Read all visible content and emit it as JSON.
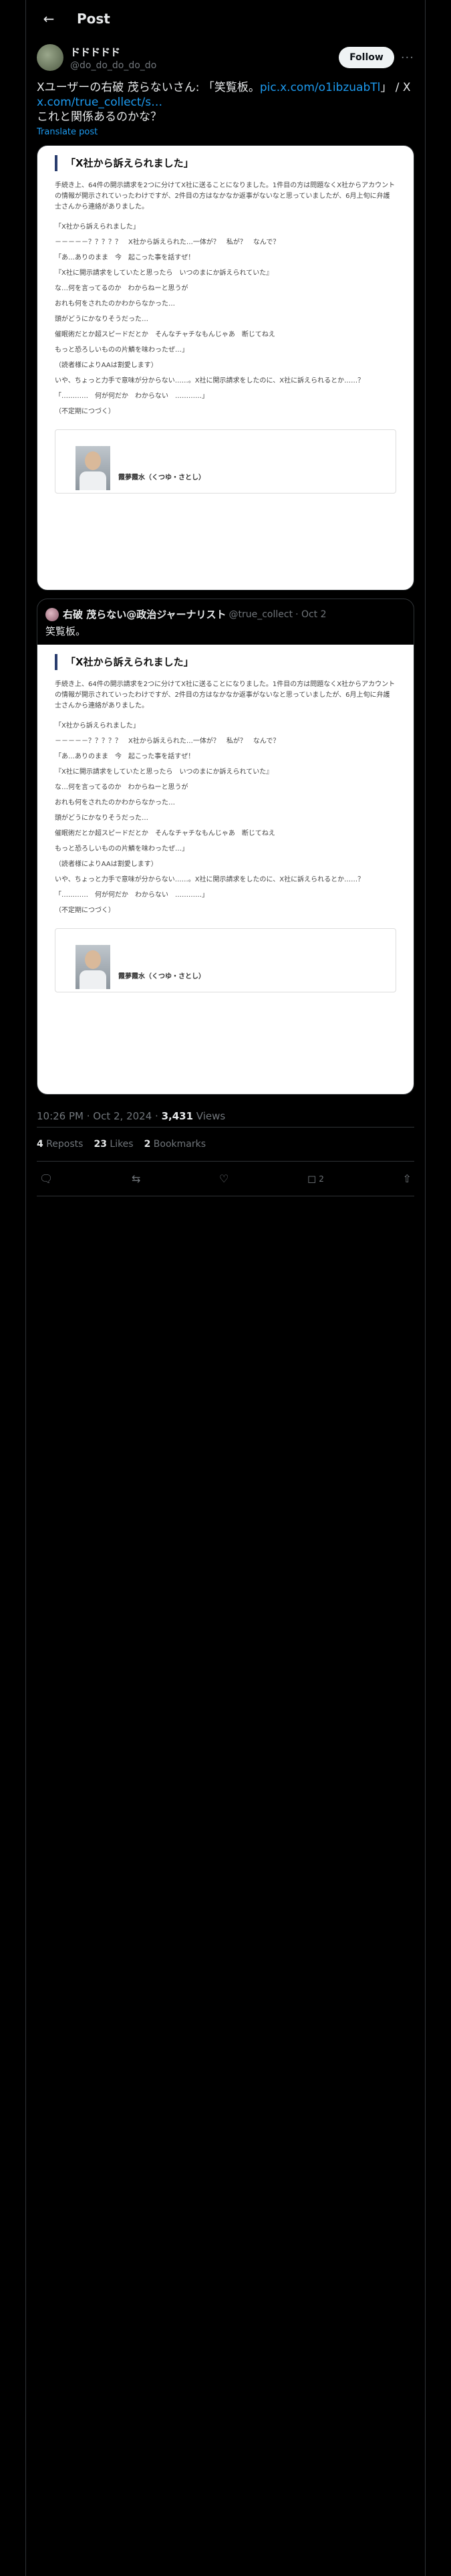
{
  "header": {
    "back_icon": "arrow-left-icon",
    "title": "Post"
  },
  "post": {
    "display_name": "ドドドドド",
    "handle": "@do_do_do_do_do",
    "follow_label": "Follow",
    "more_label": "···",
    "text_main": "Xユーザーの右破 茂らないさん: 「笑覧板。",
    "text_link1": "pic.x.com/o1ibzuabTl",
    "text_mid": "」 / X ",
    "text_link2": "x.com/true_collect/s…",
    "text_tail": "これと関係あるのかな？",
    "translate_label": "Translate post"
  },
  "article": {
    "title": "「X社から訴えられました」",
    "paragraphs": [
      "手続き上、64件の開示請求を2つに分けてX社に送ることになりました。1件目の方は問題なくX社からアカウントの情報が開示されていったわけですが、2件目の方はなかなか返事がないなと思っていましたが、6月上旬に弁護士さんから連絡がありました。",
      "「X社から訴えられました」",
      "－－－－－？？？？？　X社から訴えられた…一体が？　私が？　なんで？",
      "「あ…ありのまま　今　起こった事を話すぜ！",
      "『X社に開示請求をしていたと思ったら　いつのまにか訴えられていた』",
      "な…何を言ってるのか　わからねーと思うが",
      "おれも何をされたのかわからなかった…",
      "頭がどうにかなりそうだった…",
      "催眠術だとか超スピードだとか　そんなチャチなもんじゃあ　断じてねえ",
      "もっと恐ろしいものの片鱗を味わったぜ…」",
      "（読者様によりAAは割愛します）",
      "いや、ちょっと力手で意味が分からない……。X社に開示請求をしたのに、X社に訴えられるとか……？",
      "「…………　何が何だか　わからない　…………」",
      "（不定期につづく）"
    ],
    "author_caption": "霞夢霞水（くつゆ・さとし）"
  },
  "quote": {
    "display_name": "右破 茂らない@政治ジャーナリスト",
    "handle": "@true_collect",
    "date": "· Oct 2",
    "text": "笑覧板。"
  },
  "meta": {
    "time": "10:26 PM · Oct 2, 2024 · ",
    "views_count": "3,431",
    "views_label": " Views"
  },
  "stats": {
    "reposts_count": "4",
    "reposts_label": " Reposts",
    "likes_count": "23",
    "likes_label": " Likes",
    "bookmarks_count": "2",
    "bookmarks_label": " Bookmarks"
  },
  "actions": {
    "bookmark_count": "2"
  }
}
